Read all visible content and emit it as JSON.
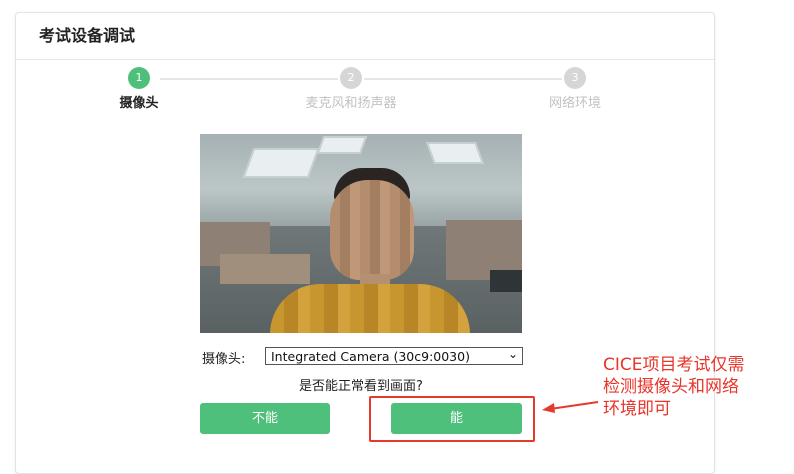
{
  "panel": {
    "title": "考试设备调试"
  },
  "steps": [
    {
      "number": "1",
      "label": "摄像头",
      "state": "active"
    },
    {
      "number": "2",
      "label": "麦克风和扬声器",
      "state": "inactive"
    },
    {
      "number": "3",
      "label": "网络环境",
      "state": "inactive"
    }
  ],
  "camera": {
    "label": "摄像头:",
    "selected": "Integrated Camera (30c9:0030)"
  },
  "question": "是否能正常看到画面?",
  "buttons": {
    "no": "不能",
    "yes": "能"
  },
  "annotation": {
    "lines": [
      "CICE项目考试仅需",
      "检测摄像头和网络",
      "环境即可"
    ]
  },
  "colors": {
    "accent": "#4fc07b",
    "annotation": "#e8342a",
    "inactive_step": "#d6d6d6"
  }
}
